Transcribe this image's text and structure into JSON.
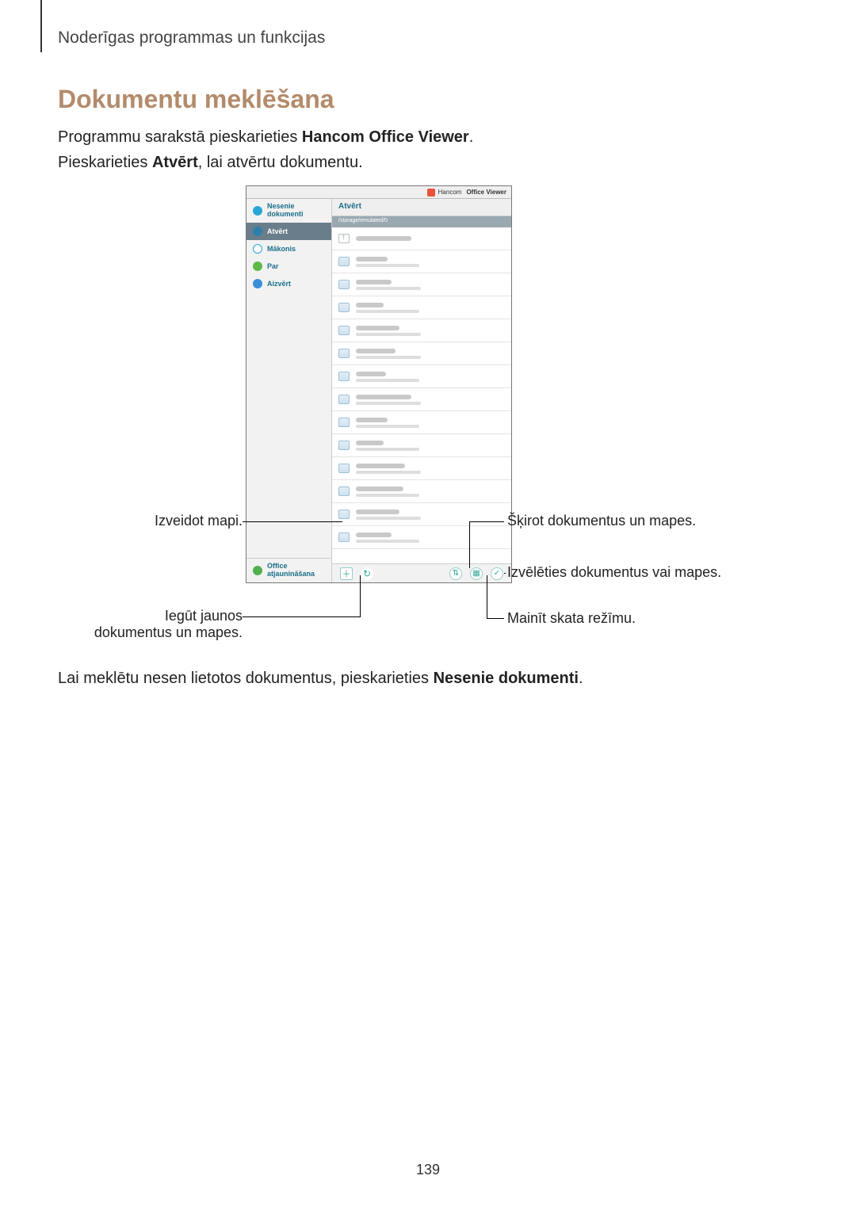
{
  "header": "Noderīgas programmas un funkcijas",
  "title": "Dokumentu meklēšana",
  "para1_pre": "Programmu sarakstā pieskarieties ",
  "para1_bold": "Hancom Office Viewer",
  "para1_post": ".",
  "para2_pre": "Pieskarieties ",
  "para2_bold": "Atvērt",
  "para2_post": ", lai atvērtu dokumentu.",
  "para3_pre": "Lai meklētu nesen lietotos dokumentus, pieskarieties ",
  "para3_bold": "Nesenie dokumenti",
  "para3_post": ".",
  "page_number": "139",
  "screenshot": {
    "app_title_brand": "Hancom",
    "app_title_rest": "Office Viewer",
    "sidebar": {
      "recent": "Nesenie dokumenti",
      "open": "Atvērt",
      "cloud": "Mākonis",
      "about": "Par",
      "close": "Aizvērt",
      "update": "Office atjaunināšana"
    },
    "main": {
      "header": "Atvērt",
      "path": "/storage/emulated/0"
    }
  },
  "callouts": {
    "create_folder": "Izveidot mapi.",
    "refresh": "Iegūt jaunos dokumentus un mapes.",
    "sort": "Šķirot dokumentus un mapes.",
    "select": "Izvēlēties dokumentus vai mapes.",
    "view": "Mainīt skata režīmu."
  }
}
